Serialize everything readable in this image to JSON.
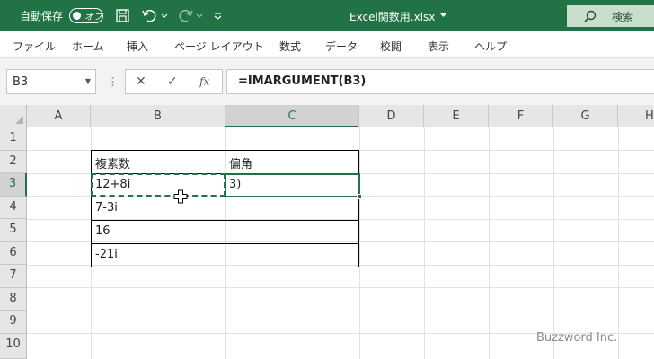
{
  "titlebar": {
    "autosave_label": "自動保存",
    "autosave_state": "オフ",
    "filename": "Excel関数用.xlsx",
    "search_label": "検索"
  },
  "ribbon": {
    "tabs": [
      "ファイル",
      "ホーム",
      "挿入",
      "ページ レイアウト",
      "数式",
      "データ",
      "校閲",
      "表示",
      "ヘルプ"
    ]
  },
  "formula_bar": {
    "name_box": "B3",
    "fx": "fx",
    "formula": "=IMARGUMENT(B3)"
  },
  "sheet": {
    "columns": [
      "A",
      "B",
      "C",
      "D",
      "E",
      "F",
      "G",
      "H"
    ],
    "rows": [
      "1",
      "2",
      "3",
      "4",
      "5",
      "6",
      "7",
      "8",
      "9",
      "10"
    ],
    "table": {
      "header_b": "複素数",
      "header_c": "偏角",
      "values": [
        "12+8i",
        "7-3i",
        "16",
        "-21i"
      ],
      "c3_edit": "3)"
    }
  },
  "watermark": "Buzzword Inc."
}
